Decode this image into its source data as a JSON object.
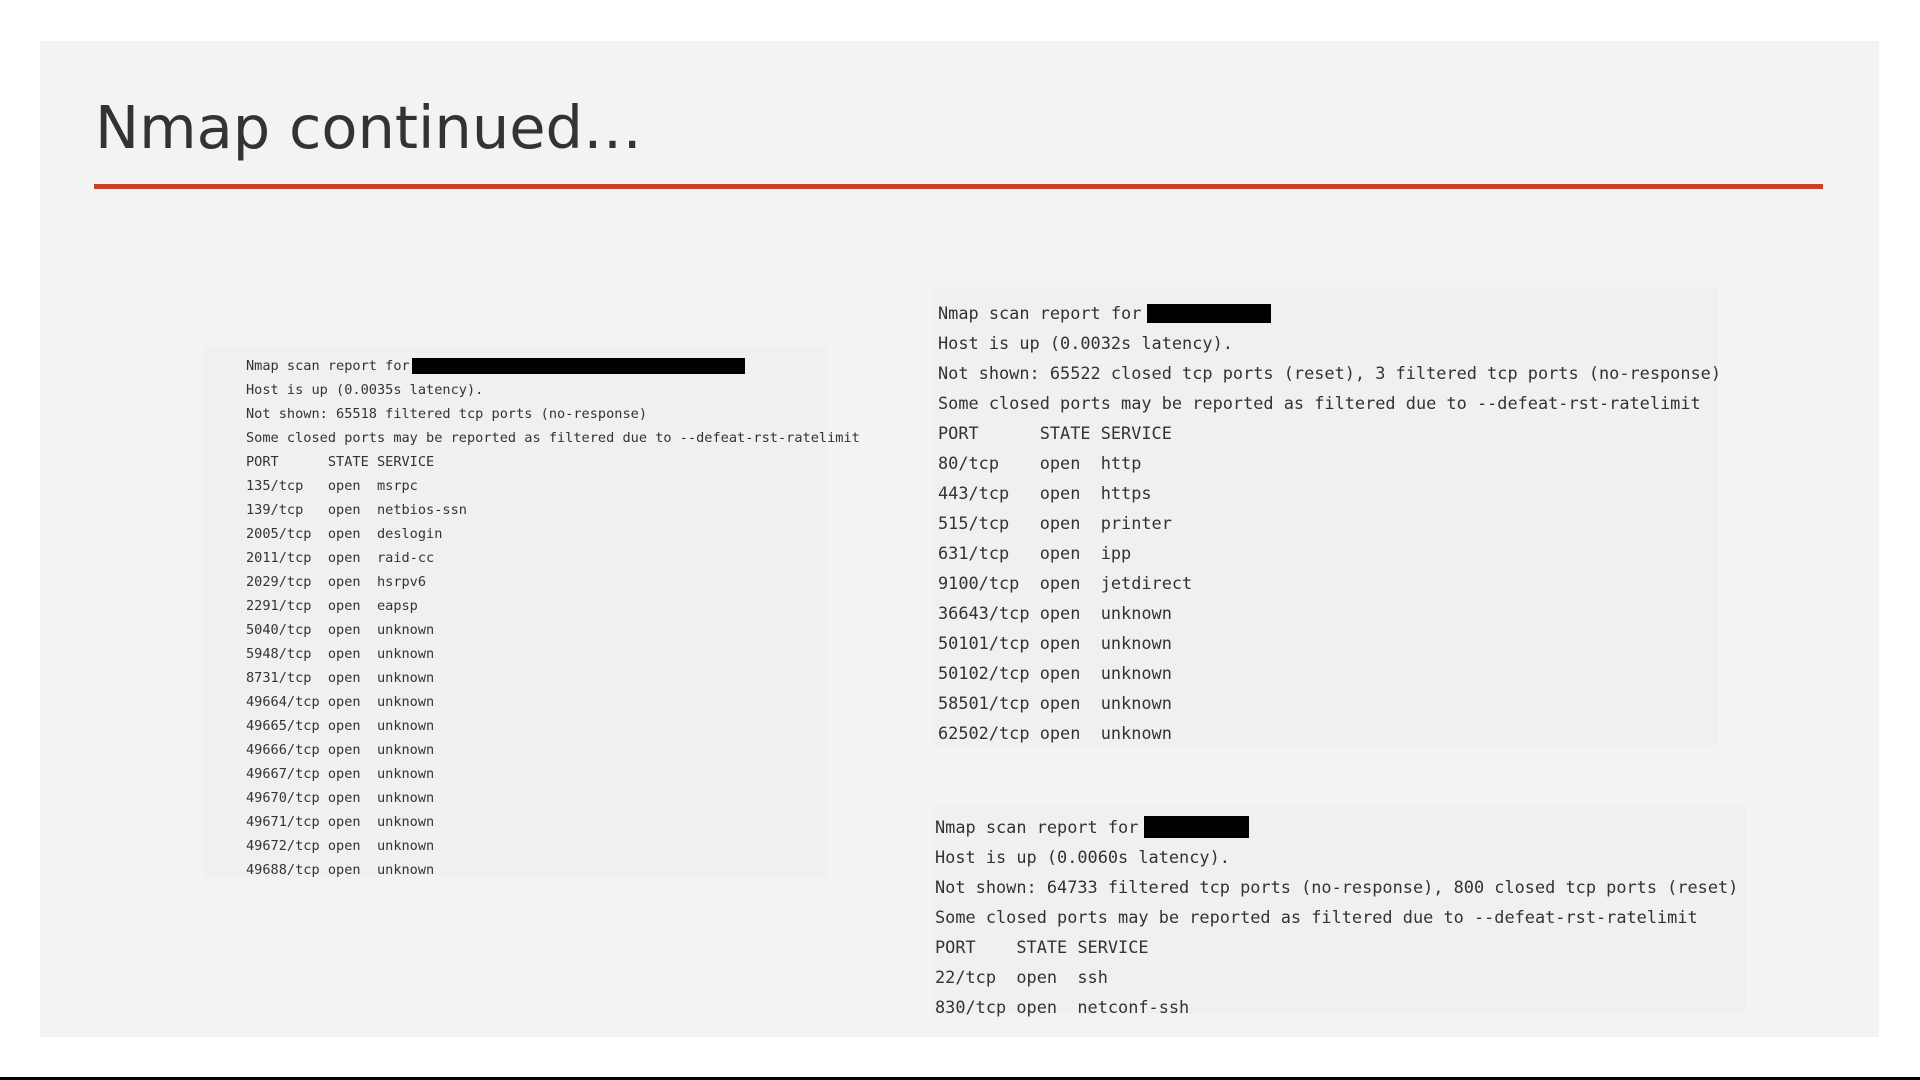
{
  "slide": {
    "title": "Nmap continued…",
    "accent_color": "#c9402d"
  },
  "scans": {
    "left": {
      "header": "Nmap scan report for",
      "header_value_redacted": true,
      "lines": [
        "Host is up (0.0035s latency).",
        "Not shown: 65518 filtered tcp ports (no-response)",
        "Some closed ports may be reported as filtered due to --defeat-rst-ratelimit",
        "PORT      STATE SERVICE",
        "135/tcp   open  msrpc",
        "139/tcp   open  netbios-ssn",
        "2005/tcp  open  deslogin",
        "2011/tcp  open  raid-cc",
        "2029/tcp  open  hsrpv6",
        "2291/tcp  open  eapsp",
        "5040/tcp  open  unknown",
        "5948/tcp  open  unknown",
        "8731/tcp  open  unknown",
        "49664/tcp open  unknown",
        "49665/tcp open  unknown",
        "49666/tcp open  unknown",
        "49667/tcp open  unknown",
        "49670/tcp open  unknown",
        "49671/tcp open  unknown",
        "49672/tcp open  unknown",
        "49688/tcp open  unknown"
      ]
    },
    "right": {
      "header": "Nmap scan report for",
      "header_value_redacted": true,
      "lines": [
        "Host is up (0.0032s latency).",
        "Not shown: 65522 closed tcp ports (reset), 3 filtered tcp ports (no-response)",
        "Some closed ports may be reported as filtered due to --defeat-rst-ratelimit",
        "PORT      STATE SERVICE",
        "80/tcp    open  http",
        "443/tcp   open  https",
        "515/tcp   open  printer",
        "631/tcp   open  ipp",
        "9100/tcp  open  jetdirect",
        "36643/tcp open  unknown",
        "50101/tcp open  unknown",
        "50102/tcp open  unknown",
        "58501/tcp open  unknown",
        "62502/tcp open  unknown"
      ]
    },
    "bottom": {
      "header": "Nmap scan report for",
      "header_value_redacted": true,
      "lines": [
        "Host is up (0.0060s latency).",
        "Not shown: 64733 filtered tcp ports (no-response), 800 closed tcp ports (reset)",
        "Some closed ports may be reported as filtered due to --defeat-rst-ratelimit",
        "PORT    STATE SERVICE",
        "22/tcp  open  ssh",
        "830/tcp open  netconf-ssh"
      ]
    }
  }
}
